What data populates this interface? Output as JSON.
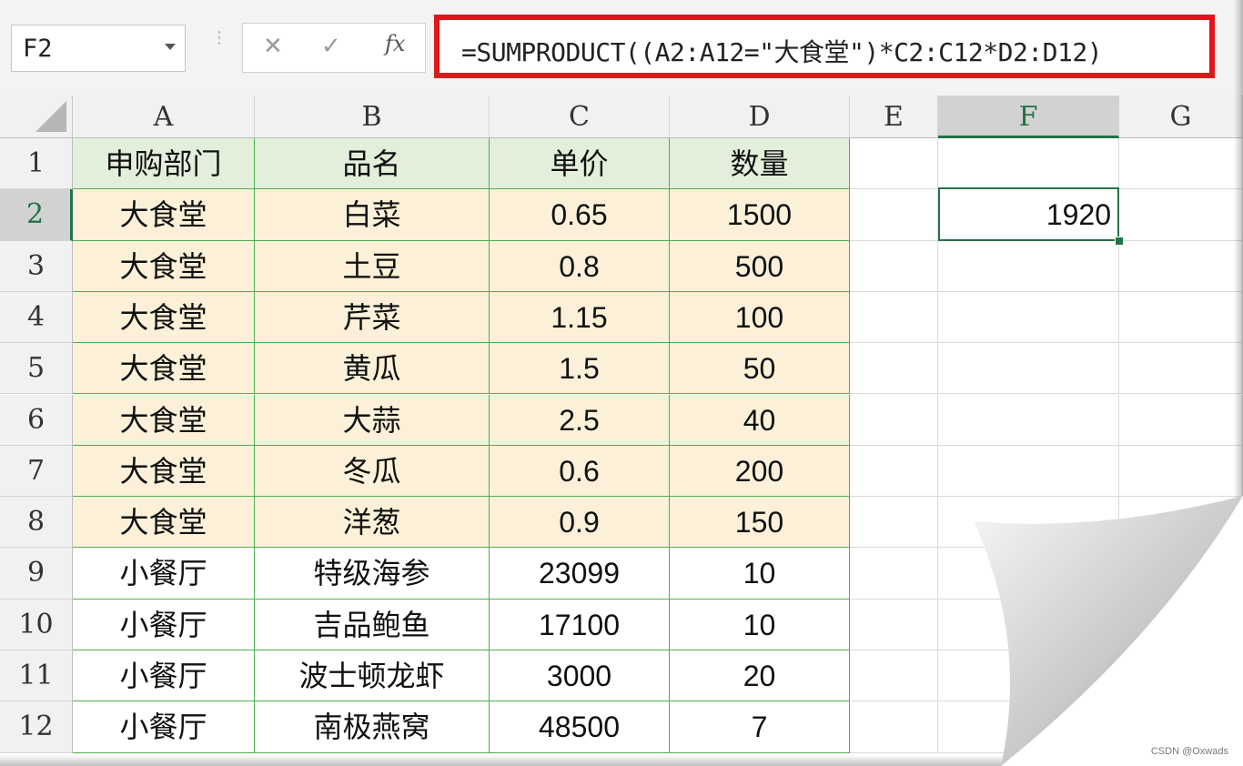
{
  "toolbar": {
    "name_box": "F2",
    "cancel_icon": "✕",
    "confirm_icon": "✓",
    "fx_label": "fx",
    "formula": "=SUMPRODUCT((A2:A12=\"大食堂\")*C2:C12*D2:D12)"
  },
  "columns": [
    "A",
    "B",
    "C",
    "D",
    "E",
    "F",
    "G"
  ],
  "selected_column": "F",
  "selected_row": "2",
  "rows": [
    "1",
    "2",
    "3",
    "4",
    "5",
    "6",
    "7",
    "8",
    "9",
    "10",
    "11",
    "12"
  ],
  "table": {
    "headers": [
      "申购部门",
      "品名",
      "单价",
      "数量"
    ],
    "records": [
      [
        "大食堂",
        "白菜",
        "0.65",
        "1500"
      ],
      [
        "大食堂",
        "土豆",
        "0.8",
        "500"
      ],
      [
        "大食堂",
        "芹菜",
        "1.15",
        "100"
      ],
      [
        "大食堂",
        "黄瓜",
        "1.5",
        "50"
      ],
      [
        "大食堂",
        "大蒜",
        "2.5",
        "40"
      ],
      [
        "大食堂",
        "冬瓜",
        "0.6",
        "200"
      ],
      [
        "大食堂",
        "洋葱",
        "0.9",
        "150"
      ],
      [
        "小餐厅",
        "特级海参",
        "23099",
        "10"
      ],
      [
        "小餐厅",
        "吉品鲍鱼",
        "17100",
        "10"
      ],
      [
        "小餐厅",
        "波士顿龙虾",
        "3000",
        "20"
      ],
      [
        "小餐厅",
        "南极燕窝",
        "48500",
        "7"
      ]
    ]
  },
  "result_cell": {
    "address": "F2",
    "value": "1920"
  },
  "watermark": "CSDN @Oxwads",
  "colors": {
    "header_fill": "#e2efda",
    "canteen_fill": "#fcf1d8",
    "formula_highlight": "#e4141b",
    "selection": "#217346"
  }
}
